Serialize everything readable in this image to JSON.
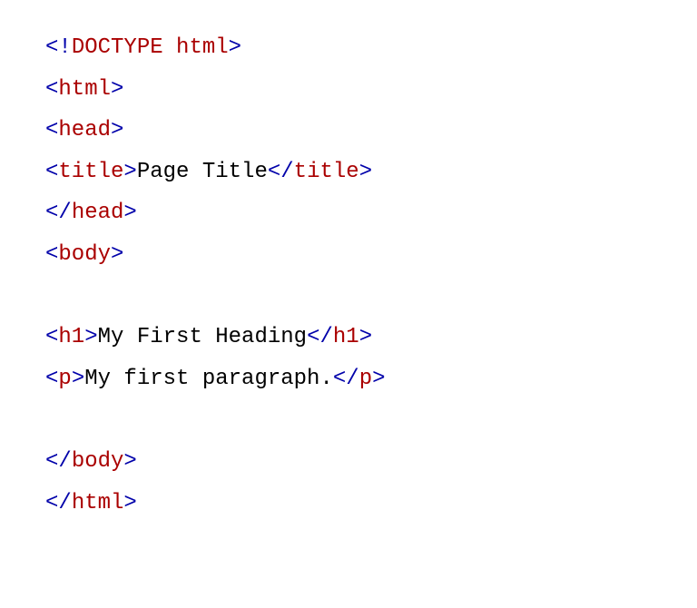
{
  "code": {
    "lines": [
      {
        "type": "doctype",
        "parts": {
          "open": "<!",
          "kw": "DOCTYPE",
          "sp": " ",
          "val": "html",
          "close": ">"
        }
      },
      {
        "type": "tag",
        "open": "<",
        "name": "html",
        "close": ">"
      },
      {
        "type": "tag",
        "open": "<",
        "name": "head",
        "close": ">"
      },
      {
        "type": "tagged_text",
        "open_tag": {
          "o": "<",
          "n": "title",
          "c": ">"
        },
        "text": "Page Title",
        "close_tag": {
          "o": "</",
          "n": "title",
          "c": ">"
        }
      },
      {
        "type": "tag",
        "open": "</",
        "name": "head",
        "close": ">"
      },
      {
        "type": "tag",
        "open": "<",
        "name": "body",
        "close": ">"
      },
      {
        "type": "blank"
      },
      {
        "type": "tagged_text",
        "open_tag": {
          "o": "<",
          "n": "h1",
          "c": ">"
        },
        "text": "My First Heading",
        "close_tag": {
          "o": "</",
          "n": "h1",
          "c": ">"
        }
      },
      {
        "type": "tagged_text",
        "open_tag": {
          "o": "<",
          "n": "p",
          "c": ">"
        },
        "text": "My first paragraph.",
        "close_tag": {
          "o": "</",
          "n": "p",
          "c": ">"
        }
      },
      {
        "type": "blank"
      },
      {
        "type": "tag",
        "open": "</",
        "name": "body",
        "close": ">"
      },
      {
        "type": "tag",
        "open": "</",
        "name": "html",
        "close": ">"
      }
    ]
  }
}
